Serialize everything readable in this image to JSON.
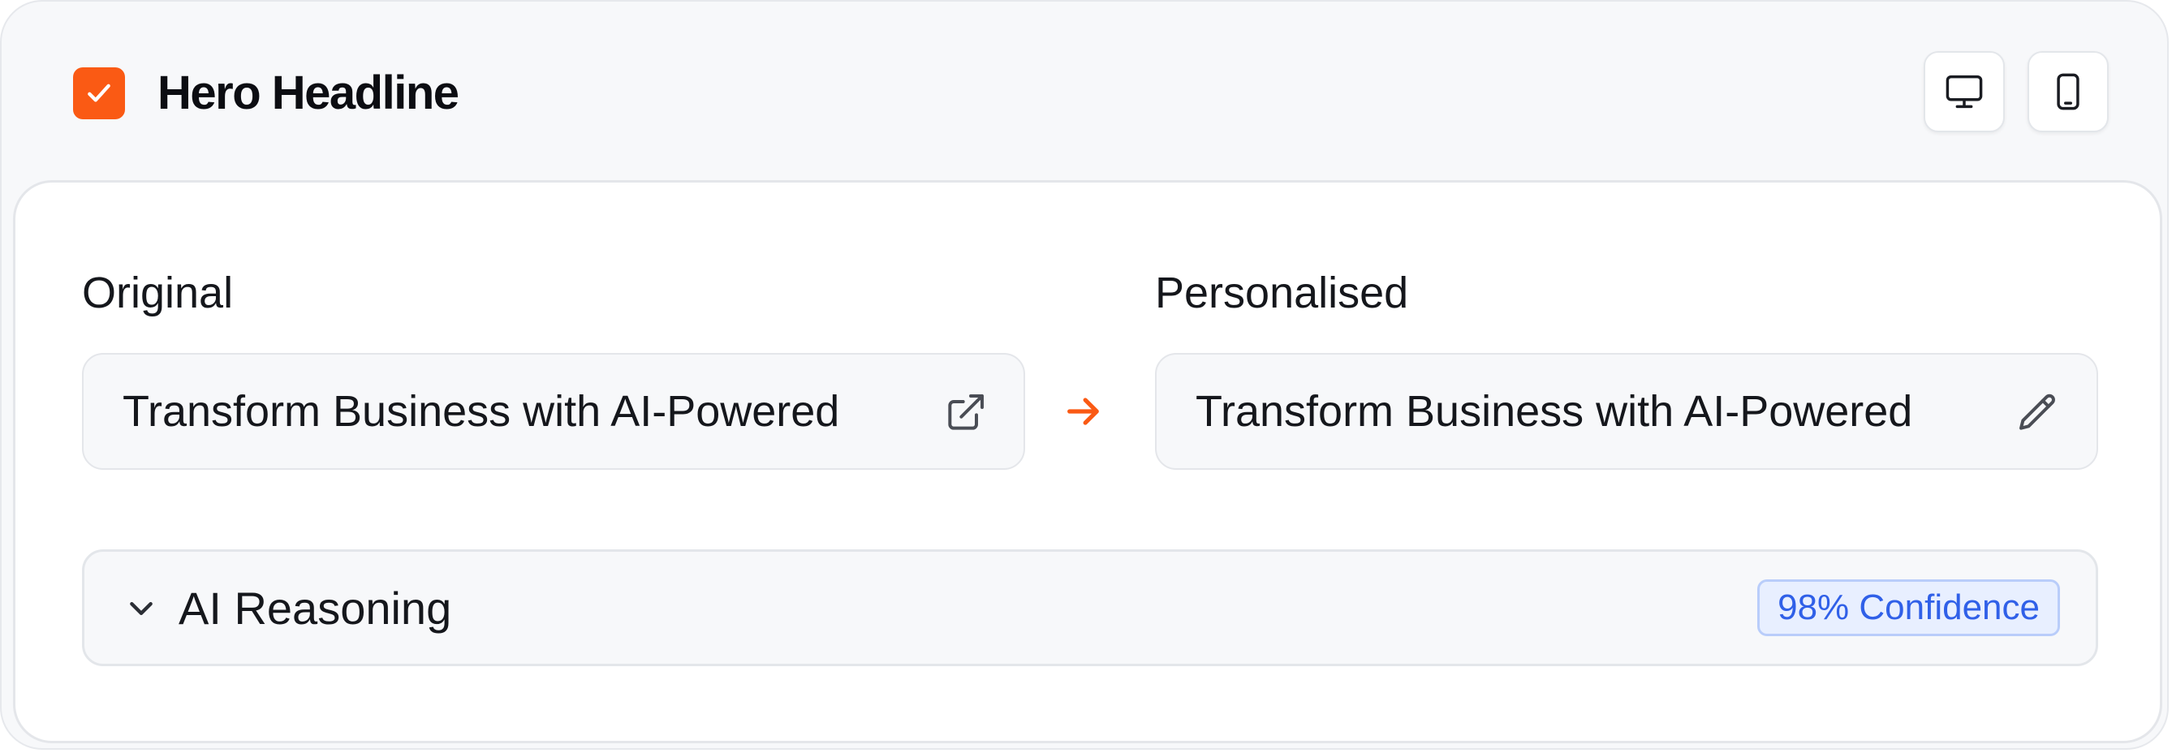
{
  "header": {
    "title": "Hero Headline",
    "checkbox_checked": true,
    "accent_color": "#fa5a14",
    "view_buttons": [
      {
        "icon": "desktop-icon"
      },
      {
        "icon": "mobile-icon"
      }
    ]
  },
  "comparison": {
    "original_label": "Original",
    "original_value": "Transform Business with AI-Powered",
    "original_icon": "external-link-icon",
    "arrow_icon": "arrow-right-icon",
    "personalised_label": "Personalised",
    "personalised_value": "Transform Business with AI-Powered",
    "personalised_icon": "pencil-icon"
  },
  "reasoning": {
    "label": "AI Reasoning",
    "expand_icon": "chevron-down-icon",
    "confidence_badge": "98% Confidence",
    "badge_color": "#3060e8"
  }
}
